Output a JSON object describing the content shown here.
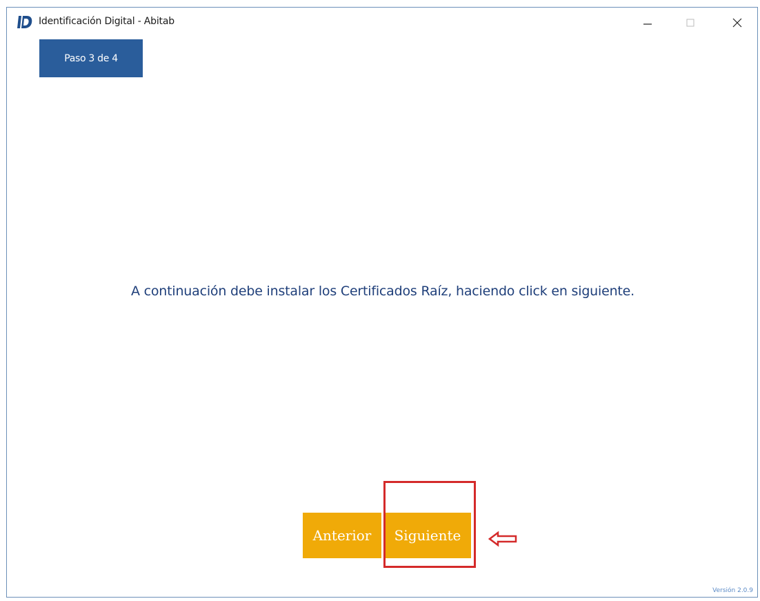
{
  "window": {
    "title": "Identificación Digital - Abitab",
    "logo_icon": "id-logo-icon"
  },
  "step": {
    "label": "Paso 3 de 4"
  },
  "content": {
    "message": "A continuación debe instalar los Certificados Raíz, haciendo click en siguiente."
  },
  "buttons": {
    "previous": "Anterior",
    "next": "Siguiente"
  },
  "footer": {
    "version": "Versión 2.0.9"
  },
  "colors": {
    "step_badge": "#2a5d9b",
    "button": "#f0aa08",
    "message_text": "#1f3f7a",
    "annotation": "#d42a2a",
    "version_text": "#5a8ac6"
  }
}
